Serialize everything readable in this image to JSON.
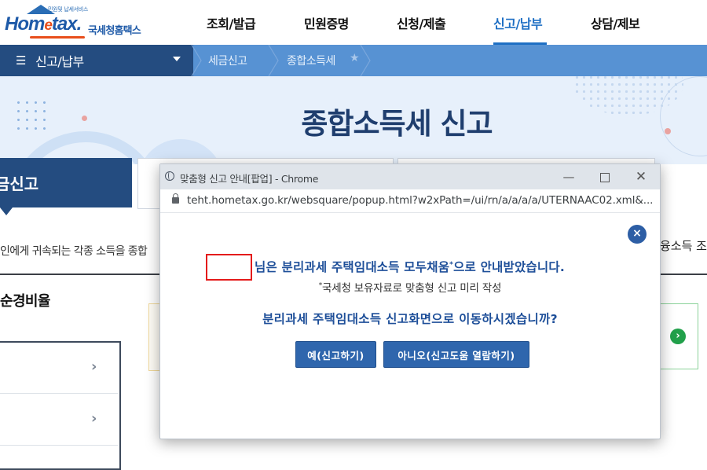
{
  "header": {
    "logo": {
      "tagline": "민원및 납세서비스",
      "wordmark_pre": "Hom",
      "wordmark_e": "e",
      "wordmark_post": "tax.",
      "name": "국세청홈택스"
    },
    "gnb": [
      "조회/발급",
      "민원증명",
      "신청/제출",
      "신고/납부",
      "상담/제보"
    ],
    "active_gnb": "신고/납부"
  },
  "locbar": {
    "menu_label": "신고/납부",
    "breadcrumb": [
      "세금신고",
      "종합소득세"
    ]
  },
  "hero": {
    "title": "종합소득세 신고"
  },
  "background": {
    "left_tab_label": "금신고",
    "body_text": "인에게 귀속되는 각종 소득을 종합",
    "right_text": "융소득 조",
    "section_heading": "순경비율"
  },
  "popup": {
    "window_title": "맞춤형 신고 안내[팝업] - Chrome",
    "url": "teht.hometax.go.kr/websquare/popup.html?w2xPath=/ui/rn/a/a/a/a/UTERNAAC02.xml&...",
    "message_main_pre": "님은 분리과세 주택임대소득 모두채움",
    "message_main_sup": "*",
    "message_main_post": "으로 안내받았습니다.",
    "message_sub_sup": "*",
    "message_sub": "국세청 보유자료로 맞춤형 신고 미리 작성",
    "question": "분리과세 주택임대소득 신고화면으로 이동하시겠습니까?",
    "yes_label": "예(신고하기)",
    "no_label": "아니오(신고도움 열람하기)",
    "close_symbol": "×"
  },
  "colors": {
    "brand_blue": "#1e5aa8",
    "nav_dark": "#244c80",
    "nav_light": "#5792d3",
    "hero_bg": "#e7f0fb",
    "highlight_red": "#e41b1b",
    "button_blue": "#2f66ad"
  }
}
